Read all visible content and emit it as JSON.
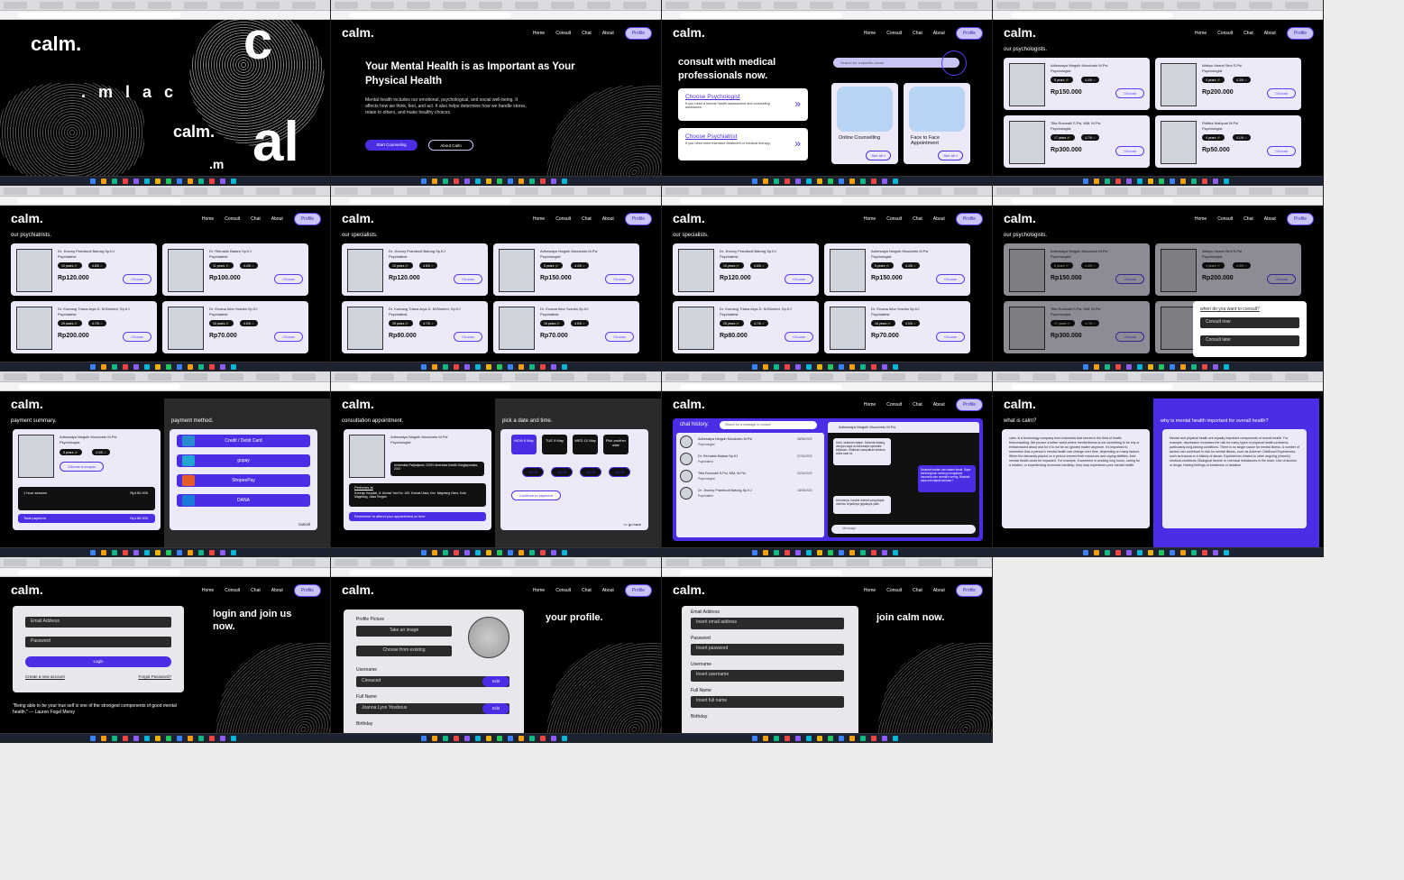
{
  "brand": {
    "logo": "calm.",
    "accent": "#4a2ee6",
    "lavender": "#c8c4f5"
  },
  "nav": {
    "home": "Home",
    "consult": "Consult",
    "chat": "Chat",
    "about": "About",
    "profile": "Profile"
  },
  "hero": {
    "title": "Your Mental Health is as Important as Your Physical Health",
    "body": "Mental health includes our emotional, psychological, and social well-being. It affects how we think, feel, and act. It also helps determine how we handle stress, relate to others, and make healthy choices.",
    "start": "Start Counseling",
    "about": "About Calm",
    "splash_logo": "calm.",
    "splash_rev": ".mlac",
    "splash_c": "c",
    "splash_al": "al",
    "splash_m": ".m",
    "splash_calm2": "calm."
  },
  "consult": {
    "title": "consult with medical professionals now.",
    "search_placeholder": "Search for a specific doctor",
    "psych_title": "Choose Psychologist",
    "psych_body": "If you need a mental health assessment and counseling assistance.",
    "psy_title": "Choose Psychiatrist",
    "psy_body": "If you need more intensive treatment or medical therapy.",
    "online": "Online Counselling",
    "f2f": "Face to Face Appointment",
    "see_all": "See all »"
  },
  "sections": {
    "psychologists": "our psychologists.",
    "psychiatrists": "our psychiatrists.",
    "specialists": "our specialists."
  },
  "choose": "Choose",
  "psychologists": [
    {
      "name": "Adhesatya Ningsih Moodoeto M.Psi",
      "role": "Psychologist",
      "years": "5 years 🎓",
      "rating": "4.4/5 ☆",
      "price": "Rp150.000"
    },
    {
      "name": "Wahyu Hasmi Simi S.Psi",
      "role": "Psychologist",
      "years": "4 years 🎓",
      "rating": "4.3/5 ☆",
      "price": "Rp200.000"
    },
    {
      "name": "Titia Rosmaili S.Psi, MM, M.Psi",
      "role": "Psychologist",
      "years": "17 years 🎓",
      "rating": "4.7/5 ☆",
      "price": "Rp300.000"
    },
    {
      "name": "Riditha Wahyuni M.Psi",
      "role": "Psychologist",
      "years": "4 years 🎓",
      "rating": "4.1/5 ☆",
      "price": "Rp50.000"
    }
  ],
  "psychiatrists": [
    {
      "name": "Dr. Jhonny Prambudi Batong Sp.KJ",
      "role": "Psychiatrist",
      "years": "10 years 🎓",
      "rating": "4.8/5 ☆",
      "price": "Rp120.000"
    },
    {
      "name": "Dr. Reinaldo Batara Sp.KJ",
      "role": "Psychiatrist",
      "years": "11 years 🎓",
      "rating": "4.4/5 ☆",
      "price": "Rp100.000"
    },
    {
      "name": "Dr. Komang Triana Arya D. M.Biomed, Sp.KJ",
      "role": "Psychiatrist",
      "years": "25 years 🎓",
      "rating": "4.7/5 ☆",
      "price": "Rp200.000"
    },
    {
      "name": "Dr. Ervana Ikha Yusnita Sp.KJ",
      "role": "Psychiatrist",
      "years": "16 years 🎓",
      "rating": "4.5/5 ☆",
      "price": "Rp70.000"
    }
  ],
  "specialists": [
    {
      "name": "Dr. Jhonny Prambudi Batong Sp.KJ",
      "role": "Psychiatrist",
      "years": "10 years 🎓",
      "rating": "4.8/5 ☆",
      "price": "Rp120.000"
    },
    {
      "name": "Adhesatya Ningsih Moodoeto M.Psi",
      "role": "Psychologist",
      "years": "5 years 🎓",
      "rating": "4.4/5 ☆",
      "price": "Rp150.000"
    },
    {
      "name": "Dr. Komang Triana Arya D. M.Biomed, Sp.KJ",
      "role": "Psychiatrist",
      "years": "25 years 🎓",
      "rating": "4.7/5 ☆",
      "price": "Rp80.000"
    },
    {
      "name": "Dr. Ervana Ikha Yusnita Sp.KJ",
      "role": "Psychiatrist",
      "years": "16 years 🎓",
      "rating": "4.5/5 ☆",
      "price": "Rp70.000"
    }
  ],
  "popup": {
    "question": "when do you want to consult?",
    "now": "Consult now",
    "later": "Consult later"
  },
  "payment": {
    "summary": "payment summary.",
    "method": "payment method.",
    "coupon": "Choose a coupon",
    "session": "1 hour session",
    "session_price": "Rp150.000",
    "total": "Total payment",
    "total_price": "Rp150.000",
    "methods": [
      "Credit / Debit Card",
      "gopay",
      "ShopeePay",
      "DANA"
    ],
    "cancel": "cancel"
  },
  "appt": {
    "title": "consultation appointment.",
    "edu": "Universitas Padjadjaran, 2009 Universitas Katolik Soegijapranata, 2013",
    "perform": "Performs at",
    "hospital": "Soeenjo Hospital, Jl. Ahmad Yani No. 169, Kramat Utara, Kec. Magelang Utara, Kota Magelang, Jawa Tengah",
    "remind": "Remember to attend your appointment on time",
    "pick": "pick a date and time.",
    "days": [
      "MON 8 May",
      "TUE 9 May",
      "WED 10 May",
      "Pick another date"
    ],
    "times": [
      "07:00",
      "10:00",
      "13:00",
      "16:00"
    ],
    "continue": "Continue to payment",
    "back": "<< go back"
  },
  "chat": {
    "title": "chat history.",
    "search_placeholder": "Search for a message or contact",
    "contacts": [
      {
        "name": "Adhesatya Ningsih Moodoeto M.Psi",
        "role": "Psychologist",
        "date": "08/05/2023"
      },
      {
        "name": "Dr. Reinaldo Batara Sp.KJ",
        "role": "Psychiatrist",
        "date": "07/04/2023"
      },
      {
        "name": "Titia Rosmaili S.Psi, MM, M.Psi",
        "role": "Psychologist",
        "date": "02/04/2023"
      },
      {
        "name": "Dr. Jhonny Prambudi Batong Sp.KJ",
        "role": "Psychiatrist",
        "date": "18/03/2023"
      }
    ],
    "active": "Adhesatya Ningsih Moodoeto M.Psi",
    "msg1": "Halo, selamat malam. Selamat datang, dengan saya di Adhesatya spesialis kejiwaan. Silahkan sampaikan keluhan anda saat ini.",
    "msg2": "Selamat malam dan salam kenal. Saya berkeinginan sedang mengalami insomnia dan semakin sering. Bisakah saya mendapat bantuan?",
    "msg3": "Umumnya, kondisi mental yang dapat memicu terjadinya gejalanya yaitu",
    "input": "Message"
  },
  "about": {
    "what": "what is calm?",
    "why": "why is mental health important for overall health?",
    "what_body": "calm. is a technology company from Indonesia that serves in the field of health teleconsulting. We pursue a better world where mental illness is not something to be shy or embarrassed about and for it to not be an ignored matter anymore. It's important to remember that a person's mental health can change over time, depending on many factors. When the demands placed on a person exceed their resources and coping abilities, their mental health could be impacted. For example, if someone is working long hours, caring for a relative, or experiencing economic hardship, they may experience poor mental health.",
    "why_body": "Mental and physical health are equally important components of overall health. For example, depression increases the risk for many types of physical health problems, particularly long-lasting conditions. There is no single cause for mental illness. A number of factors can contribute to risk for mental illness, such as Adverse Childhood Experiences, such as trauma or a history of abuse; Experiences related to other ongoing (chronic) medical conditions; Biological factors or chemical imbalances in the brain; Use of alcohol or drugs; Having feelings of loneliness or isolation"
  },
  "login": {
    "email": "Email Address",
    "password": "Password",
    "login": "Login",
    "create": "Create a new account",
    "forgot": "Forgot Password?",
    "title": "login and join us now.",
    "quote": "\"Being able to be your true self is one of the strongest components of good mental health.\" — Lauren Fogel Mersy"
  },
  "profile": {
    "picture": "Profile Picture",
    "take": "Take an image",
    "existing": "Choose from existing",
    "username": "Username",
    "username_val": "Cinnaced",
    "fullname": "Full Name",
    "fullname_val": "Joanna Lynn Yosdorus",
    "birthday": "Birthday",
    "edit": "Edit",
    "title": "your profile."
  },
  "signup": {
    "email": "Email Address",
    "email_ph": "Insert email address",
    "password": "Password",
    "password_ph": "Insert password",
    "username": "Username",
    "username_ph": "Insert username",
    "fullname": "Full Name",
    "fullname_ph": "Insert full name",
    "birthday": "Birthday",
    "title": "join calm now."
  }
}
